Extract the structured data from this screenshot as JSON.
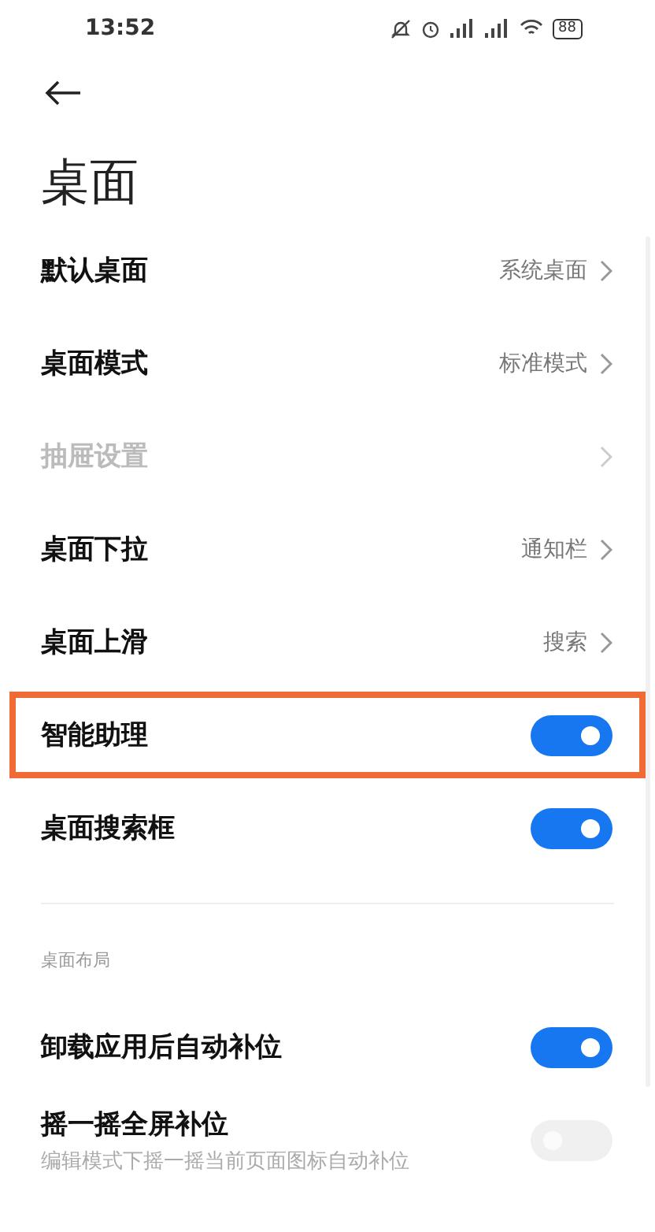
{
  "status_bar": {
    "time": "13:52",
    "battery": "88"
  },
  "title": "桌面",
  "rows": [
    {
      "kind": "nav",
      "label": "默认桌面",
      "value": "系统桌面",
      "disabled": false,
      "highlighted": false
    },
    {
      "kind": "nav",
      "label": "桌面模式",
      "value": "标准模式",
      "disabled": false,
      "highlighted": false
    },
    {
      "kind": "nav",
      "label": "抽屉设置",
      "disabled": true,
      "highlighted": false
    },
    {
      "kind": "nav",
      "label": "桌面下拉",
      "value": "通知栏",
      "disabled": false,
      "highlighted": false
    },
    {
      "kind": "nav",
      "label": "桌面上滑",
      "value": "搜索",
      "disabled": false,
      "highlighted": false
    },
    {
      "kind": "toggle",
      "label": "智能助理",
      "on": true,
      "disabled": false,
      "highlighted": true
    },
    {
      "kind": "toggle",
      "label": "桌面搜索框",
      "on": true,
      "disabled": false,
      "highlighted": false
    }
  ],
  "section": {
    "title": "桌面布局",
    "rows": [
      {
        "kind": "toggle",
        "label": "卸载应用后自动补位",
        "on": true,
        "disabled": false,
        "highlighted": false
      },
      {
        "kind": "toggle",
        "label": "摇一摇全屏补位",
        "description": "编辑模式下摇一摇当前页面图标自动补位",
        "on": false,
        "disabled": true,
        "highlighted": false
      }
    ]
  }
}
